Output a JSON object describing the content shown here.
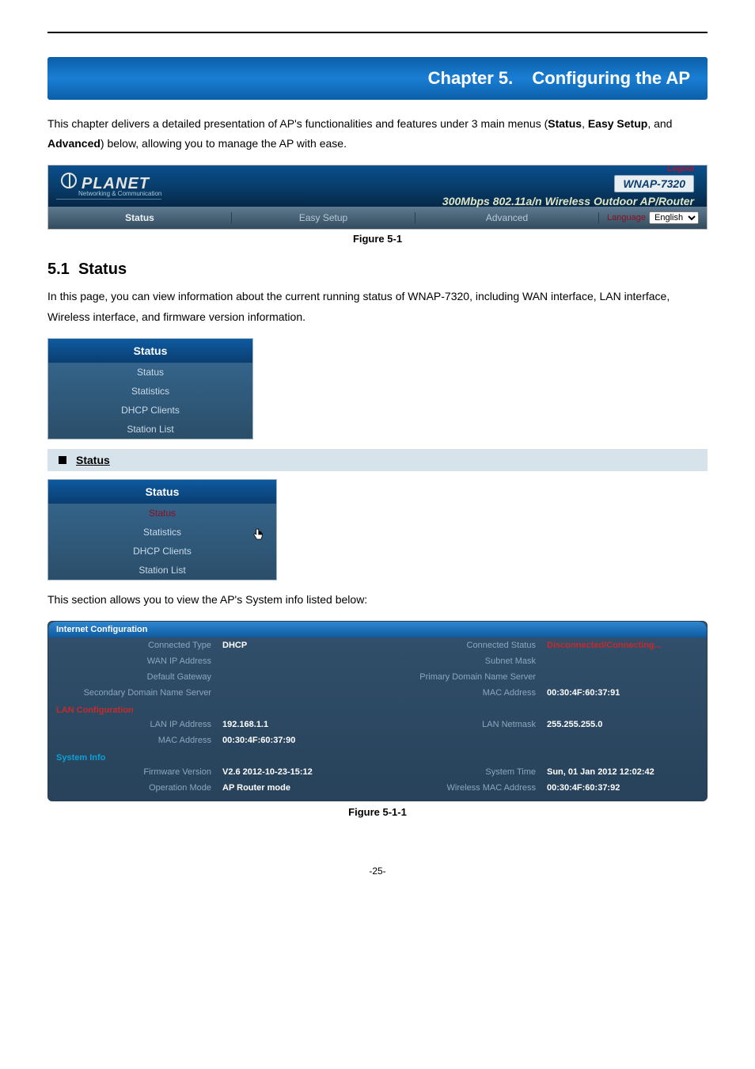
{
  "chapter": {
    "number": "Chapter 5.",
    "title": "Configuring the AP"
  },
  "intro": {
    "t1": "This chapter delivers a detailed presentation of AP's functionalities and features under 3 main menus (",
    "status": "Status",
    "t2": ", ",
    "easy": "Easy Setup",
    "t3": ", and ",
    "adv": "Advanced",
    "t4": ") below, allowing you to manage the AP with ease."
  },
  "nav": {
    "logo_text": "PLANET",
    "logo_sub": "Networking & Communication",
    "logout": "Logout",
    "model": "WNAP-7320",
    "tagline": "300Mbps 802.11a/n Wireless Outdoor AP/Router",
    "tabs": {
      "status": "Status",
      "easy": "Easy Setup",
      "advanced": "Advanced"
    },
    "lang_label": "Language",
    "lang_value": "English"
  },
  "fig1": "Figure 5-1",
  "section": {
    "num": "5.1",
    "title": "Status"
  },
  "section_body": "In this page, you can view information about the current running status of WNAP-7320, including WAN interface, LAN interface, Wireless interface, and firmware version information.",
  "panel": {
    "hdr": "Status",
    "items": [
      "Status",
      "Statistics",
      "DHCP Clients",
      "Station List"
    ]
  },
  "sub_status": "Status",
  "panel2_hover": "Statistics",
  "body2": "This section allows you to view the AP's System info listed below:",
  "cfg": {
    "internet_hdr": "Internet Configuration",
    "rows_internet": [
      {
        "l1": "Connected Type",
        "v1": "DHCP",
        "l2": "Connected Status",
        "v2": "Disconnected/Connecting...",
        "v2red": true
      },
      {
        "l1": "WAN IP Address",
        "v1": "",
        "l2": "Subnet Mask",
        "v2": ""
      },
      {
        "l1": "Default Gateway",
        "v1": "",
        "l2": "Primary Domain Name Server",
        "v2": ""
      },
      {
        "l1": "Secondary Domain Name Server",
        "v1": "",
        "l2": "MAC Address",
        "v2": "00:30:4F:60:37:91"
      }
    ],
    "lan_hdr": "LAN Configuration",
    "rows_lan": [
      {
        "l1": "LAN IP Address",
        "v1": "192.168.1.1",
        "l2": "LAN Netmask",
        "v2": "255.255.255.0"
      },
      {
        "l1": "MAC Address",
        "v1": "00:30:4F:60:37:90",
        "l2": "",
        "v2": ""
      }
    ],
    "sys_hdr": "System Info",
    "rows_sys": [
      {
        "l1": "Firmware Version",
        "v1": "V2.6 2012-10-23-15:12",
        "l2": "System Time",
        "v2": "Sun, 01 Jan 2012 12:02:42"
      },
      {
        "l1": "Operation Mode",
        "v1": "AP Router mode",
        "l2": "Wireless MAC Address",
        "v2": "00:30:4F:60:37:92"
      }
    ]
  },
  "fig2": "Figure 5-1-1",
  "pagenum": "-25-"
}
